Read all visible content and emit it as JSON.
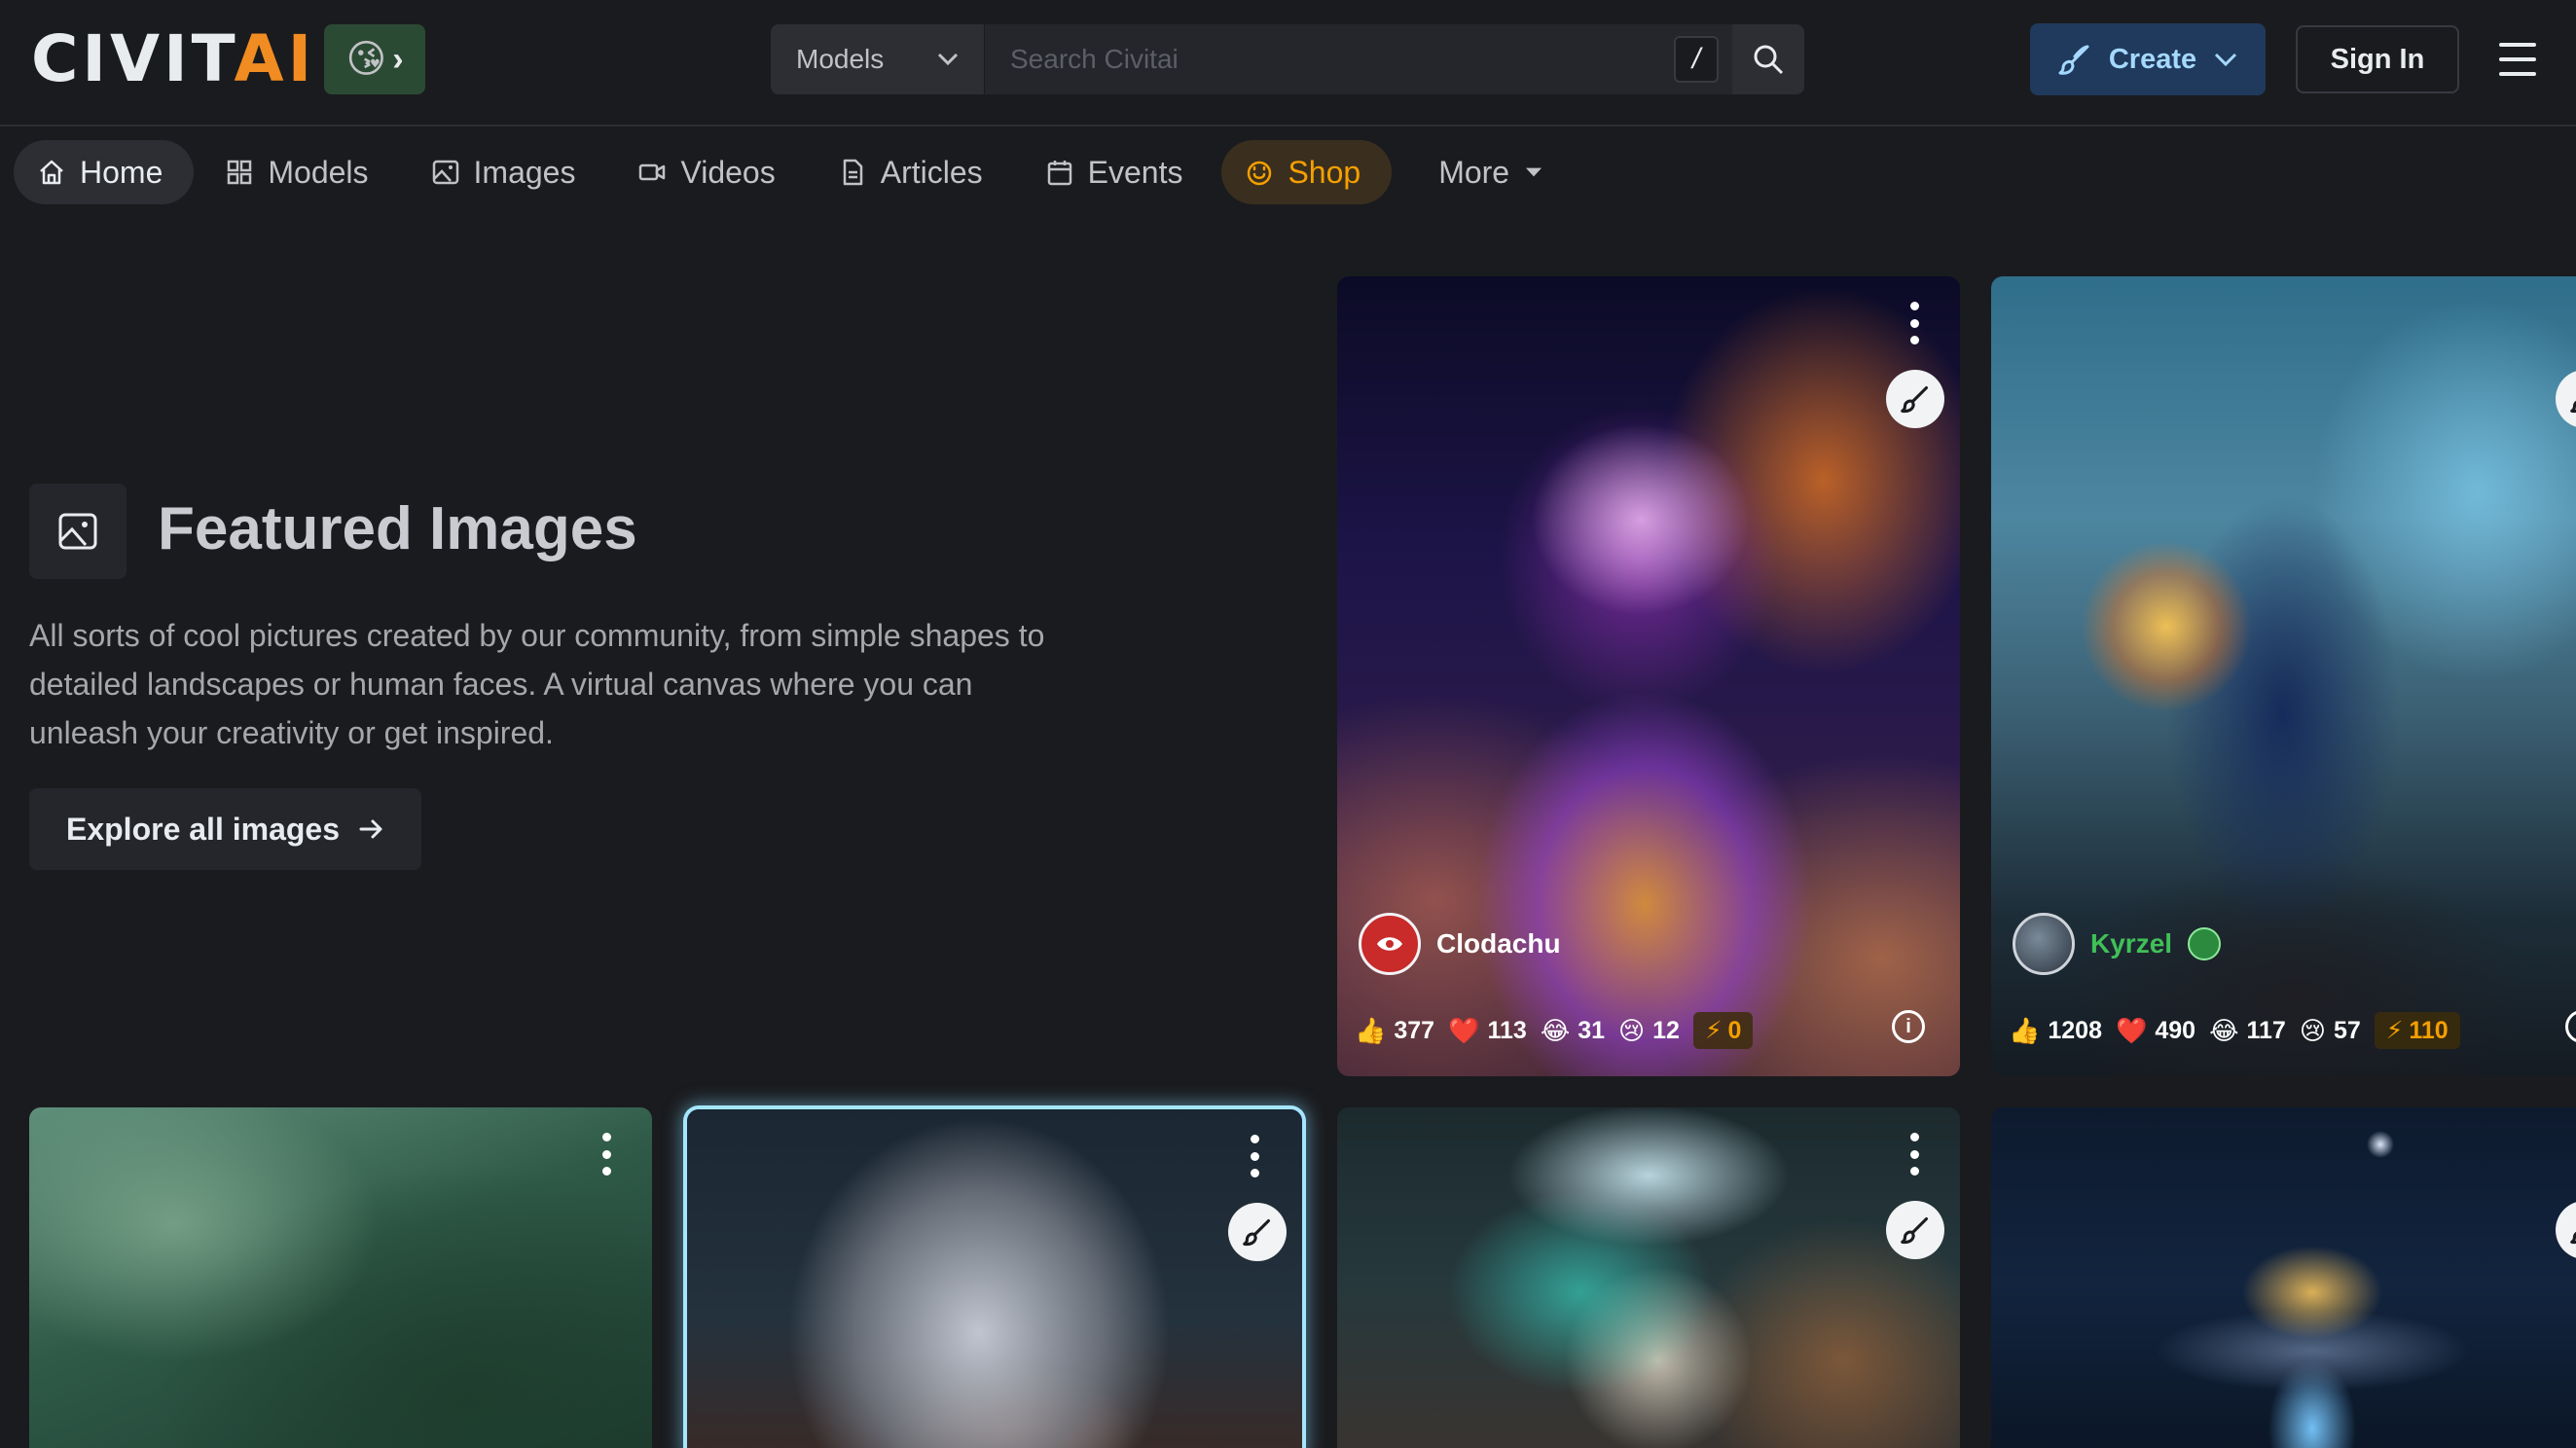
{
  "header": {
    "logo": {
      "civit": "CIVIT",
      "ai": "AI"
    },
    "emoji_button": {
      "emoji": "😘",
      "chevron": "›"
    },
    "search": {
      "category": "Models",
      "placeholder": "Search Civitai",
      "shortcut": "/"
    },
    "create_label": "Create",
    "signin_label": "Sign In"
  },
  "nav": {
    "items": [
      {
        "label": "Home"
      },
      {
        "label": "Models"
      },
      {
        "label": "Images"
      },
      {
        "label": "Videos"
      },
      {
        "label": "Articles"
      },
      {
        "label": "Events"
      },
      {
        "label": "Shop"
      },
      {
        "label": "More"
      }
    ]
  },
  "featured": {
    "title": "Featured Images",
    "description": "All sorts of cool pictures created by our community, from simple shapes to detailed landscapes or human faces. A virtual canvas where you can unleash your creativity or get inspired.",
    "explore_label": "Explore all images"
  },
  "cards": [
    {
      "username": "Clodachu",
      "likes": "377",
      "hearts": "113",
      "laughs": "31",
      "cries": "12",
      "buzz": "0"
    },
    {
      "username": "Kyrzel",
      "likes": "1208",
      "hearts": "490",
      "laughs": "117",
      "cries": "57",
      "buzz": "110"
    }
  ],
  "colors": {
    "accent": "#f08c21",
    "background": "#1a1b1e",
    "create": "#1f3a5c",
    "shop": "#f59f00",
    "username_green": "#40c057"
  }
}
